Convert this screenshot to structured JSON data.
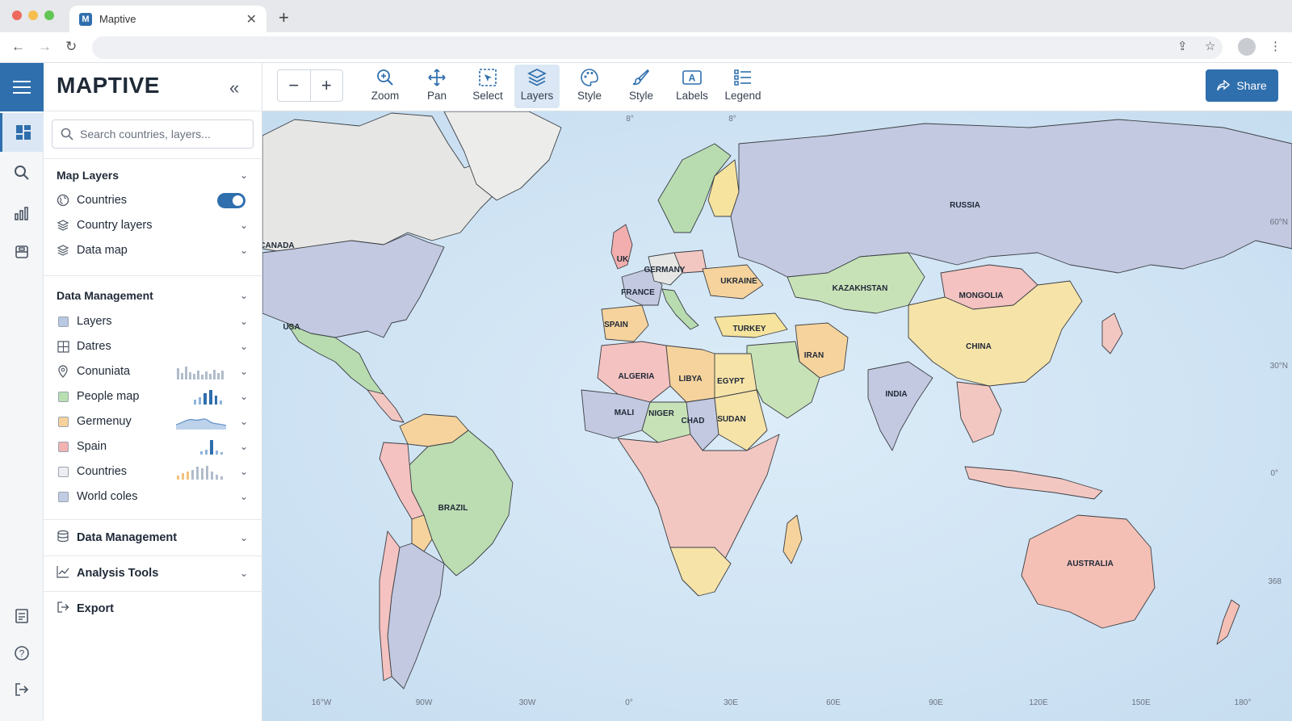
{
  "browser": {
    "tab_title": "Maptive",
    "favicon_letter": "M",
    "traffic_colors": [
      "#ee6a5e",
      "#f5be4f",
      "#62c554"
    ]
  },
  "app": {
    "brand": "MAPTIVE",
    "accent": "#2f6fad",
    "search_placeholder": "Search countries, layers..."
  },
  "toolbar": {
    "tools": [
      {
        "label": "Zoom",
        "icon": "zoom-icon"
      },
      {
        "label": "Pan",
        "icon": "pan-icon"
      },
      {
        "label": "Select",
        "icon": "select-icon"
      },
      {
        "label": "Layers",
        "icon": "layers-icon",
        "active": true
      },
      {
        "label": "Style",
        "icon": "palette-icon"
      },
      {
        "label": "Style",
        "icon": "brush-icon"
      },
      {
        "label": "Labels",
        "icon": "labels-icon"
      },
      {
        "label": "Legend",
        "icon": "legend-icon"
      }
    ],
    "share_label": "Share"
  },
  "sidebar": {
    "map_layers": {
      "title": "Map Layers",
      "items": [
        {
          "label": "Countries",
          "toggle": true
        },
        {
          "label": "Country layers"
        },
        {
          "label": "Data map"
        }
      ]
    },
    "data_management": {
      "title": "Data Management",
      "items": [
        {
          "label": "Layers",
          "swatch": "#b9c9e3"
        },
        {
          "label": "Datres",
          "icon": "grid-icon"
        },
        {
          "label": "Conuniata",
          "icon": "pin-icon"
        },
        {
          "label": "People map",
          "swatch": "#b7dfb0"
        },
        {
          "label": "Germenuy",
          "swatch": "#f6d29a"
        },
        {
          "label": "Spain",
          "swatch": "#f2b3b3"
        },
        {
          "label": "Countries",
          "swatch": "#e5e7eb"
        },
        {
          "label": "World coles",
          "swatch": "#c2cde3"
        }
      ]
    },
    "footer_sections": [
      {
        "label": "Data Management",
        "icon": "database-icon"
      },
      {
        "label": "Analysis Tools",
        "icon": "chart-line-icon"
      }
    ],
    "export_label": "Export"
  },
  "map": {
    "country_labels": [
      "RUSSIA",
      "CANADA",
      "USA",
      "UK",
      "GERMANY",
      "FRANCE",
      "UKRAINE",
      "SPAIN",
      "TURKEY",
      "KAZAKHSTAN",
      "MONGOLIA",
      "CHINA",
      "IRAN",
      "INDIA",
      "ALGERIA",
      "LIBYA",
      "EGYPT",
      "MALI",
      "NIGER",
      "CHAD",
      "SUDAN",
      "BRAZIL",
      "AUSTRALIA"
    ],
    "lon_labels": [
      "16°W",
      "90W",
      "30W",
      "0°",
      "30E",
      "60E",
      "90E",
      "120E",
      "150E",
      "180°"
    ],
    "lat_labels": [
      "60°N",
      "30°N",
      "0°",
      "368"
    ],
    "top_labels": [
      "8°",
      "8°"
    ]
  }
}
